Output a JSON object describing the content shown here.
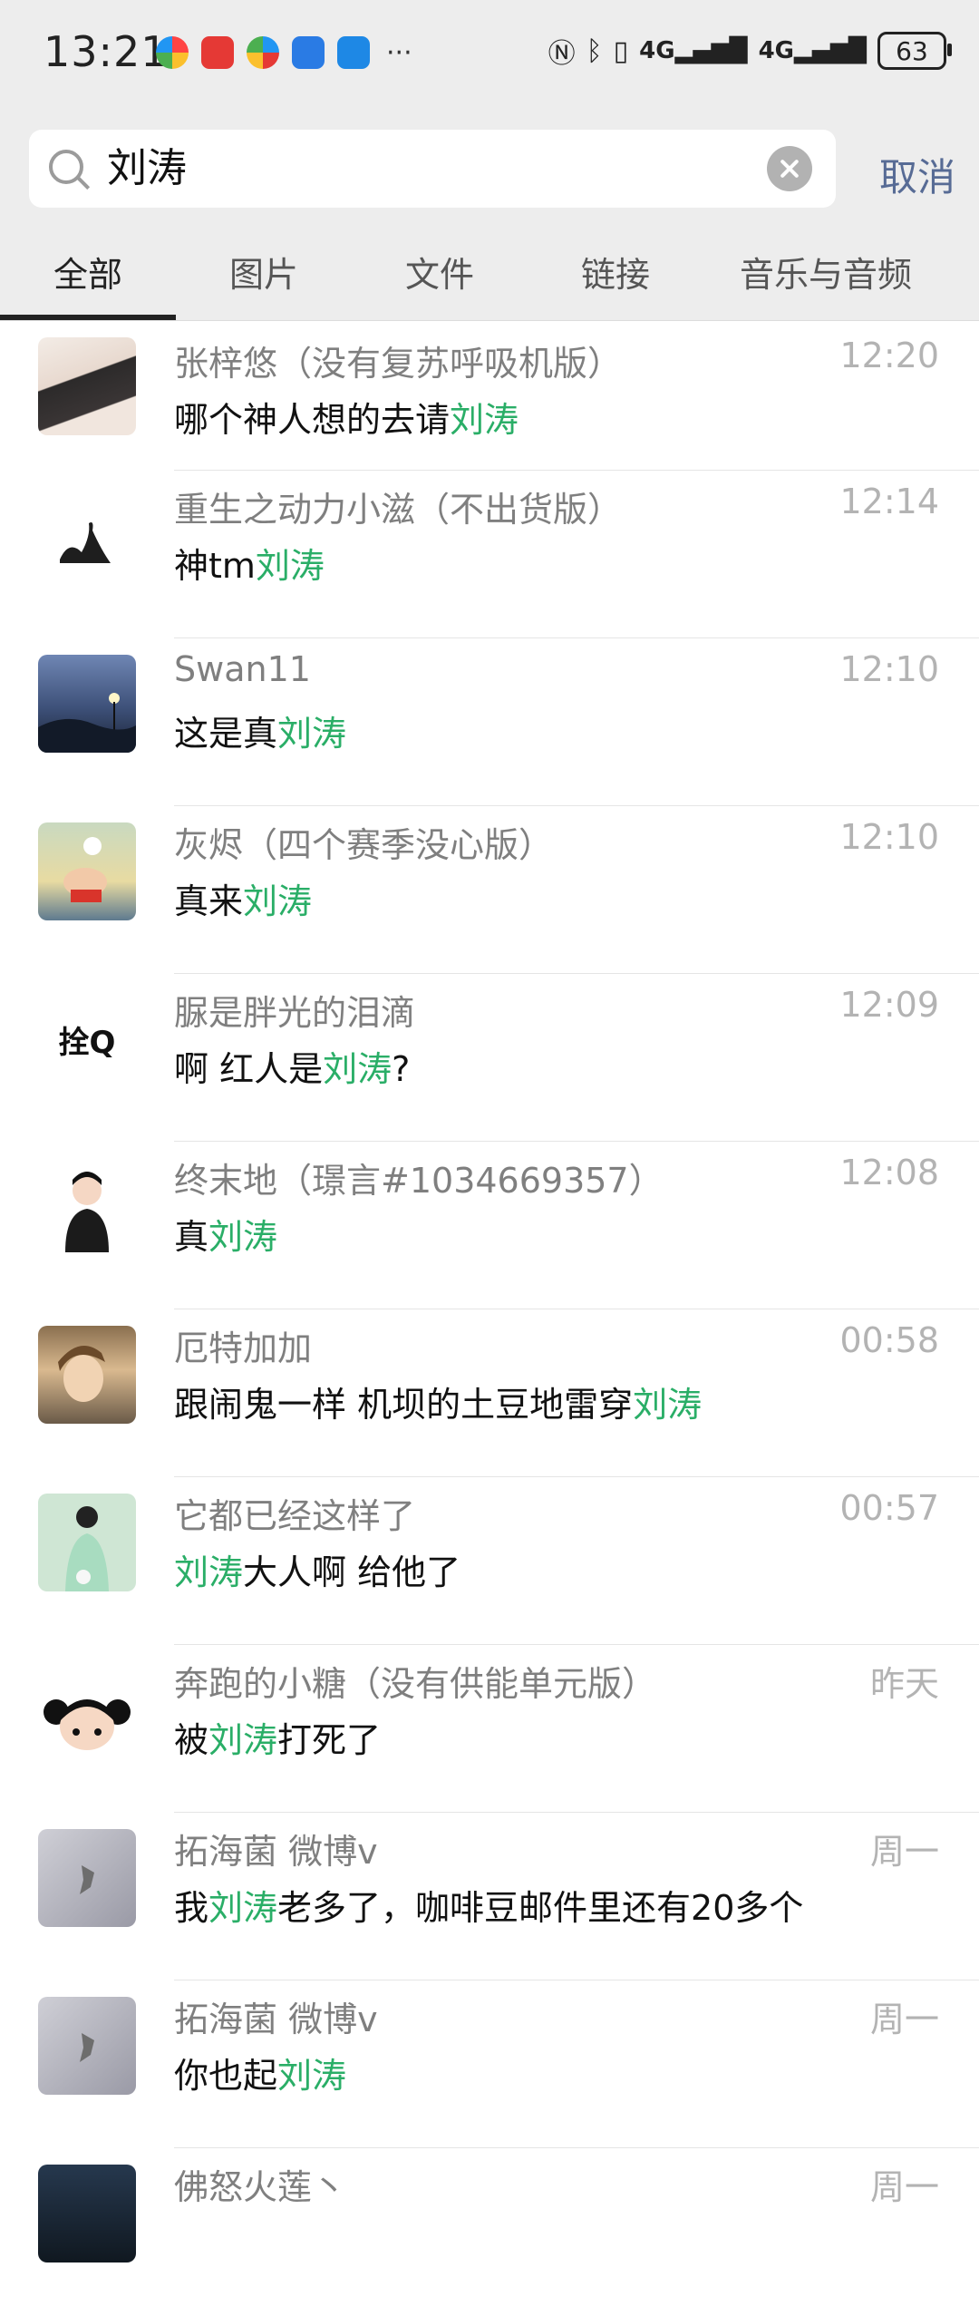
{
  "status_bar": {
    "time": "13:21",
    "more": "···",
    "network1": "4G",
    "network2": "4G",
    "battery": "63"
  },
  "search": {
    "query": "刘涛",
    "cancel_label": "取消"
  },
  "tabs": [
    {
      "label": "全部",
      "active": true
    },
    {
      "label": "图片"
    },
    {
      "label": "文件"
    },
    {
      "label": "链接"
    },
    {
      "label": "音乐与音频"
    }
  ],
  "results": [
    {
      "name": "张梓悠（没有复苏呼吸机版）",
      "time": "12:20",
      "pre": "哪个神人想的去请",
      "hl": "刘涛",
      "post": ""
    },
    {
      "name": "重生之动力小滋（不出货版）",
      "time": "12:14",
      "pre": "神tm",
      "hl": "刘涛",
      "post": ""
    },
    {
      "name": "Swan11",
      "time": "12:10",
      "pre": "这是真",
      "hl": "刘涛",
      "post": ""
    },
    {
      "name": "灰烬（四个赛季没心版）",
      "time": "12:10",
      "pre": "真来",
      "hl": "刘涛",
      "post": ""
    },
    {
      "name": "脲是胖光的泪滴",
      "time": "12:09",
      "pre": "啊 红人是",
      "hl": "刘涛",
      "post": "?"
    },
    {
      "name": "终末地（璟言#1034669357）",
      "time": "12:08",
      "pre": "真",
      "hl": "刘涛",
      "post": ""
    },
    {
      "name": "厄特加加",
      "time": "00:58",
      "pre": "跟闹鬼一样 机坝的土豆地雷穿",
      "hl": "刘涛",
      "post": ""
    },
    {
      "name": "它都已经这样了",
      "time": "00:57",
      "pre": "",
      "hl": "刘涛",
      "post": "大人啊  给他了"
    },
    {
      "name": "奔跑的小糖（没有供能单元版）",
      "time": "昨天",
      "pre": "被",
      "hl": "刘涛",
      "post": "打死了"
    },
    {
      "name": "拓海菌 微博v",
      "time": "周一",
      "pre": "我",
      "hl": "刘涛",
      "post": "老多了，咖啡豆邮件里还有20多个"
    },
    {
      "name": "拓海菌 微博v",
      "time": "周一",
      "pre": "你也起",
      "hl": "刘涛",
      "post": ""
    },
    {
      "name": "佛怒火莲丶",
      "time": "周一",
      "pre": "",
      "hl": "",
      "post": ""
    }
  ],
  "avatar_text": "拴Q",
  "highlight_color": "#2aae67",
  "link_color": "#576b95"
}
